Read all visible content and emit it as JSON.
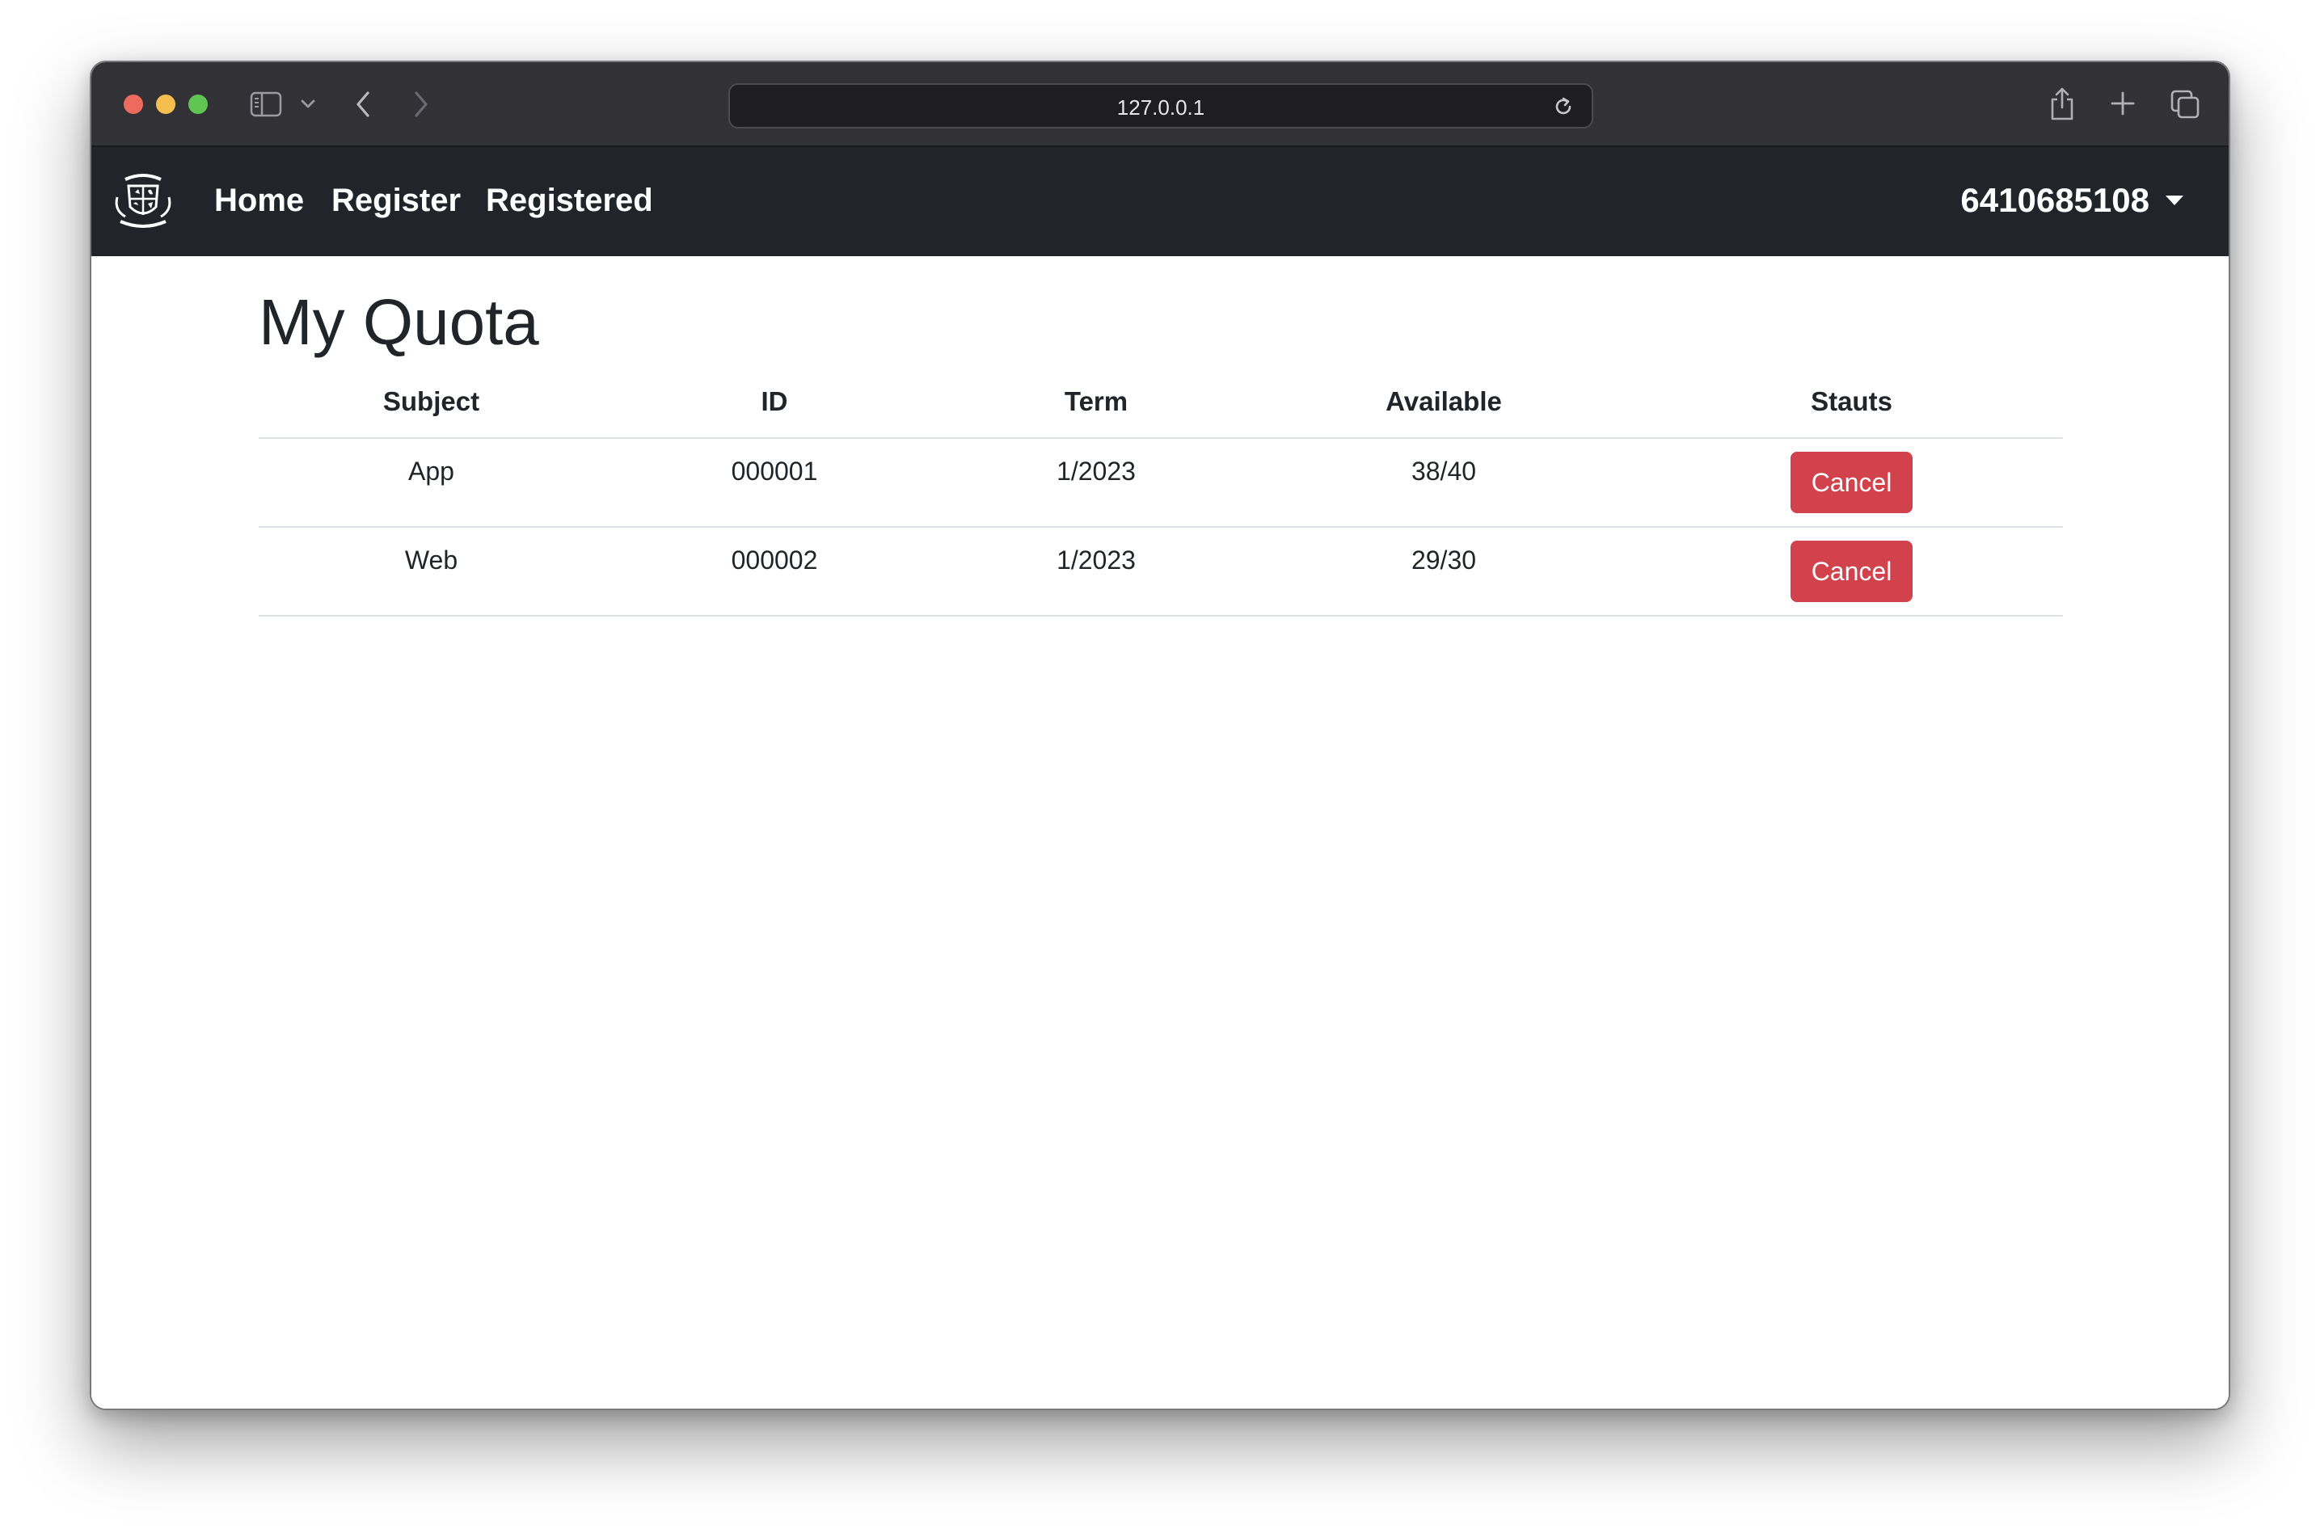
{
  "browser": {
    "url": "127.0.0.1"
  },
  "navbar": {
    "links": {
      "home": "Home",
      "register": "Register",
      "registered": "Registered"
    },
    "user_id": "6410685108"
  },
  "main": {
    "title": "My Quota",
    "table": {
      "headers": [
        "Subject",
        "ID",
        "Term",
        "Available",
        "Stauts"
      ],
      "rows": [
        {
          "subject": "App",
          "id": "000001",
          "term": "1/2023",
          "available": "38/40",
          "action_label": "Cancel"
        },
        {
          "subject": "Web",
          "id": "000002",
          "term": "1/2023",
          "available": "29/30",
          "action_label": "Cancel"
        }
      ]
    }
  },
  "colors": {
    "navbar_bg": "#212529",
    "cancel_button": "#dc3545",
    "chrome_bg": "#323236"
  }
}
